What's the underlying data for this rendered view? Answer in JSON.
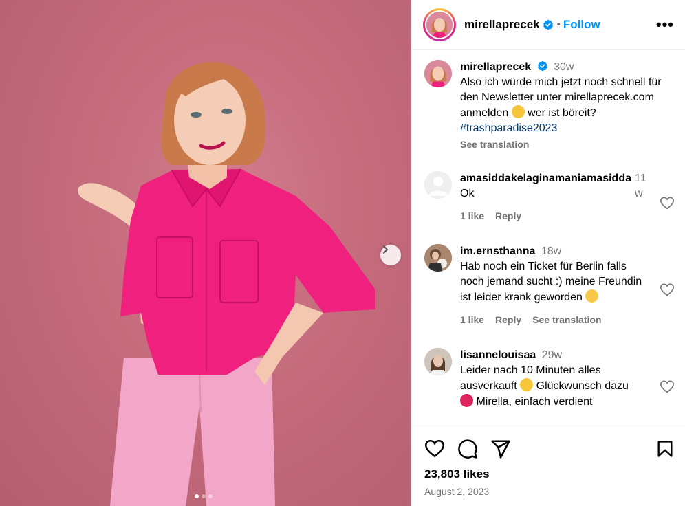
{
  "post": {
    "username": "mirellaprecek",
    "follow_label": "Follow",
    "separator": "•",
    "more_label": "•••"
  },
  "caption": {
    "username": "mirellaprecek",
    "time": "30w",
    "text_before": "Also ich würde mich jetzt noch schnell für den Newsletter unter mirellaprecek.com anmelden",
    "text_after": " wer ist böreit? ",
    "hashtag": "#trashparadise2023",
    "see_translation": "See translation"
  },
  "comments": [
    {
      "username": "amasiddakelaginamaniamasidda",
      "time": "11w",
      "text": "Ok",
      "likes": "1 like",
      "reply": "Reply"
    },
    {
      "username": "im.ernsthanna",
      "time": "18w",
      "text": "Hab noch ein Ticket für Berlin falls noch jemand sucht :) meine Freundin ist leider krank geworden",
      "likes": "1 like",
      "reply": "Reply",
      "see_translation": "See translation"
    },
    {
      "username": "lisannelouisaa",
      "time": "29w",
      "text_before": "Leider nach 10 Minuten alles ausverkauft",
      "text_after": " Glückwunsch dazu",
      "text_cut": "Mirella, einfach verdient"
    }
  ],
  "footer": {
    "likes": "23,803 likes",
    "date": "August 2, 2023"
  },
  "carousel": {
    "current": 1,
    "total": 3
  },
  "colors": {
    "accent": "#0095f6",
    "muted": "#737373",
    "hashtag": "#00376b",
    "shirt": "#f0207f",
    "pants": "#f2a6c8",
    "backdrop": "#c46b7c"
  },
  "icons": [
    "verified-badge-icon",
    "more-options-icon",
    "heart-icon",
    "comment-icon",
    "share-icon",
    "bookmark-icon",
    "chevron-right-icon"
  ]
}
